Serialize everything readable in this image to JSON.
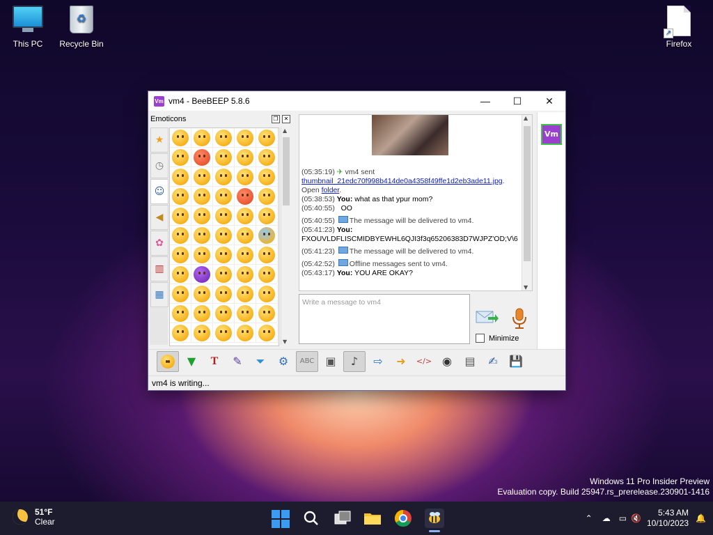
{
  "desktop": {
    "icons": [
      {
        "label": "This PC",
        "icon": "monitor-icon"
      },
      {
        "label": "Recycle Bin",
        "icon": "recycle-bin-icon"
      },
      {
        "label": "Firefox",
        "icon": "file-shortcut-icon"
      }
    ]
  },
  "window": {
    "title": "vm4 - BeeBEEP 5.8.6",
    "app_badge": "Vm",
    "controls": {
      "minimize": "—",
      "maximize": "☐",
      "close": "✕"
    }
  },
  "emoticons": {
    "title": "Emoticons",
    "categories": [
      "star-icon",
      "clock-icon",
      "smiley-category-icon",
      "speaker-icon",
      "flower-icon",
      "building-icon",
      "symbols-icon"
    ],
    "selected_category": 2
  },
  "chat": {
    "messages": [
      {
        "time": "(05:35:19)",
        "text": "vm4 sent"
      },
      {
        "link": "thumbnail_21edc70f998b414de0a4358f49ffe1d2eb3ade11.jpg",
        "suffix": "."
      },
      {
        "prefix": "Open ",
        "link": "folder",
        "suffix": "."
      },
      {
        "time": "(05:38:53)",
        "sender": "You:",
        "text": "what as that ypur mom?"
      },
      {
        "time": "(05:40:55)",
        "text": "OO"
      },
      {
        "time": "(05:40:55)",
        "text": "The message will be delivered to vm4."
      },
      {
        "time": "(05:41:23)",
        "sender": "You:",
        "text": ""
      },
      {
        "text": "FXOUVLDFLISCMIDBYEWHL6QJI3f3q65206383D7WJPZ'OD;V\\6"
      },
      {
        "time": "(05:41:23)",
        "text": "The message will be delivered to vm4."
      },
      {
        "time": "(05:42:52)",
        "text": "Offline messages sent to vm4."
      },
      {
        "time": "(05:43:17)",
        "sender": "You:",
        "text": "YOU ARE OKAY?"
      }
    ]
  },
  "composer": {
    "placeholder": "Write a message to vm4",
    "minimize_label": "Minimize"
  },
  "user_badge": "Vm",
  "status": {
    "text": "vm4 is writing..."
  },
  "watermark": {
    "line1": "Windows 11 Pro Insider Preview",
    "line2": "Evaluation copy. Build 25947.rs_prerelease.230901-1416"
  },
  "taskbar": {
    "weather_temp": "51°F",
    "weather_desc": "Clear",
    "time": "5:43 AM",
    "date": "10/10/2023"
  }
}
